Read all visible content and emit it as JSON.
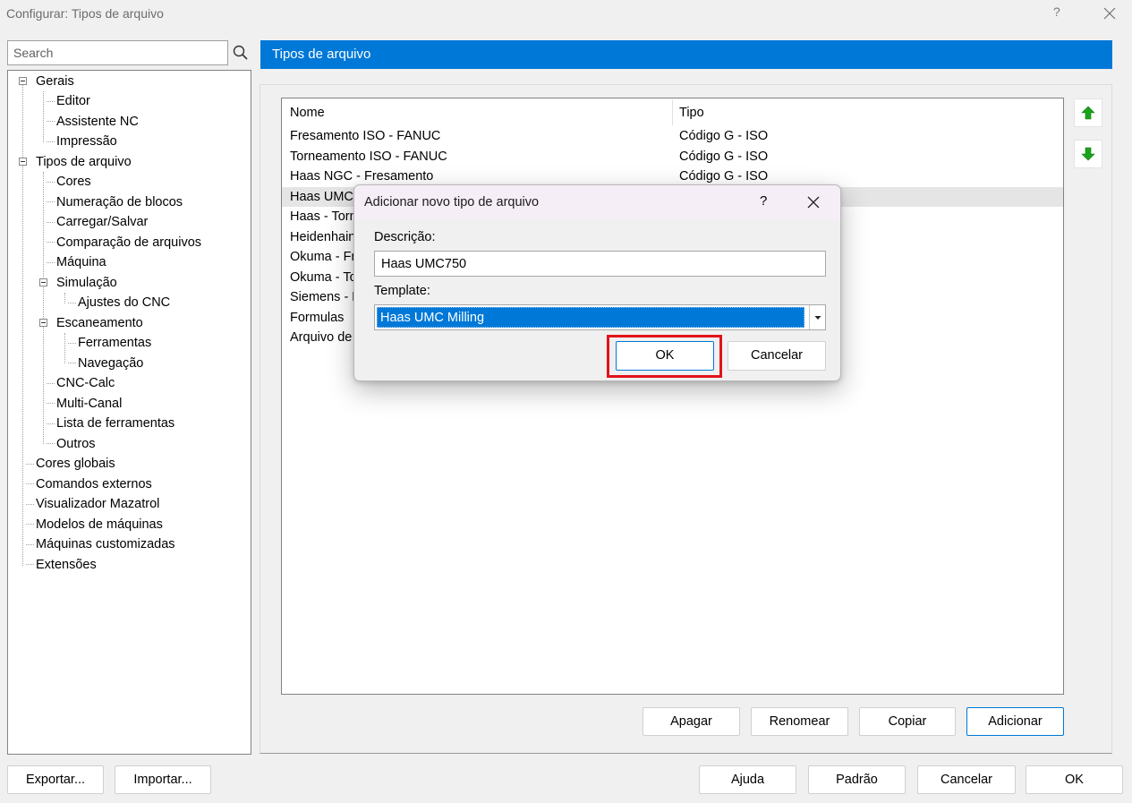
{
  "window": {
    "title": "Configurar: Tipos de arquivo",
    "help": "?",
    "close_icon": "close-icon"
  },
  "search": {
    "placeholder": "Search",
    "icon": "search-icon"
  },
  "tree": {
    "items": [
      {
        "label": "Gerais",
        "level": 0,
        "expander": true
      },
      {
        "label": "Editor",
        "level": 1
      },
      {
        "label": "Assistente NC",
        "level": 1
      },
      {
        "label": "Impressão",
        "level": 1
      },
      {
        "label": "Tipos de arquivo",
        "level": 0,
        "expander": true,
        "selected": true
      },
      {
        "label": "Cores",
        "level": 1
      },
      {
        "label": "Numeração de blocos",
        "level": 1
      },
      {
        "label": "Carregar/Salvar",
        "level": 1
      },
      {
        "label": "Comparação de arquivos",
        "level": 1
      },
      {
        "label": "Máquina",
        "level": 1
      },
      {
        "label": "Simulação",
        "level": 1,
        "expander": true
      },
      {
        "label": "Ajustes do CNC",
        "level": 2
      },
      {
        "label": "Escaneamento",
        "level": 1,
        "expander": true
      },
      {
        "label": "Ferramentas",
        "level": 2
      },
      {
        "label": "Navegação",
        "level": 2
      },
      {
        "label": "CNC-Calc",
        "level": 1
      },
      {
        "label": "Multi-Canal",
        "level": 1
      },
      {
        "label": "Lista de ferramentas",
        "level": 1
      },
      {
        "label": "Outros",
        "level": 1
      },
      {
        "label": "Cores globais",
        "level": 0
      },
      {
        "label": "Comandos externos",
        "level": 0
      },
      {
        "label": "Visualizador Mazatrol",
        "level": 0
      },
      {
        "label": "Modelos de máquinas",
        "level": 0
      },
      {
        "label": "Máquinas customizadas",
        "level": 0
      },
      {
        "label": "Extensões",
        "level": 0
      }
    ]
  },
  "section": {
    "title": "Tipos de arquivo"
  },
  "list": {
    "columns": [
      "Nome",
      "Tipo"
    ],
    "rows": [
      {
        "name": "Fresamento ISO - FANUC",
        "type": "Código G - ISO"
      },
      {
        "name": "Torneamento ISO - FANUC",
        "type": "Código G - ISO"
      },
      {
        "name": "Haas NGC - Fresamento",
        "type": "Código G - ISO"
      },
      {
        "name": "Haas UMC",
        "type": "",
        "selected": true
      },
      {
        "name": "Haas - Torn",
        "type": ""
      },
      {
        "name": "Heidenhain",
        "type": ""
      },
      {
        "name": "Okuma - Fr",
        "type": ""
      },
      {
        "name": "Okuma - To",
        "type": ""
      },
      {
        "name": "Siemens - F",
        "type": ""
      },
      {
        "name": "Formulas",
        "type": ""
      },
      {
        "name": "Arquivo de",
        "type": ""
      }
    ]
  },
  "side_buttons": {
    "up_icon": "arrow-up-icon",
    "down_icon": "arrow-down-icon",
    "arrow_color": "#1aa31a"
  },
  "list_buttons": {
    "delete": "Apagar",
    "rename": "Renomear",
    "copy": "Copiar",
    "add": "Adicionar"
  },
  "footer": {
    "export": "Exportar...",
    "import": "Importar...",
    "help": "Ajuda",
    "default": "Padrão",
    "cancel": "Cancelar",
    "ok": "OK"
  },
  "dialog": {
    "title": "Adicionar novo tipo de arquivo",
    "help": "?",
    "description_label": "Descrição:",
    "description_value": "Haas UMC750",
    "template_label": "Template:",
    "template_value": "Haas UMC Milling",
    "ok": "OK",
    "cancel": "Cancelar",
    "highlight_color": "#e2121b"
  },
  "colors": {
    "accent": "#0078d7",
    "background": "#f0f0f0"
  }
}
